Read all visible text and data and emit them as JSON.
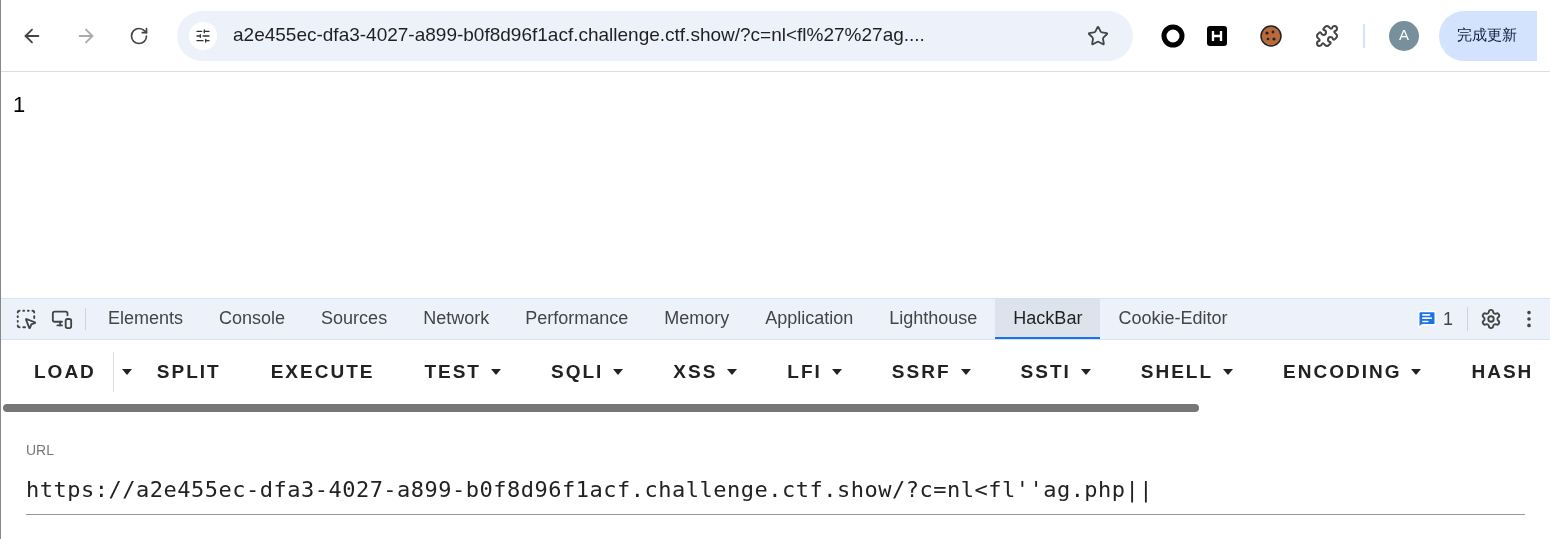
{
  "browser": {
    "address": "a2e455ec-dfa3-4027-a899-b0f8d96f1acf.challenge.ctf.show/?c=nl<fl%27%27ag....",
    "forward_disabled": true,
    "avatar": "A",
    "update_button": "完成更新"
  },
  "page": {
    "text": "1"
  },
  "devtools": {
    "tabs": [
      {
        "label": "Elements",
        "selected": false
      },
      {
        "label": "Console",
        "selected": false
      },
      {
        "label": "Sources",
        "selected": false
      },
      {
        "label": "Network",
        "selected": false
      },
      {
        "label": "Performance",
        "selected": false
      },
      {
        "label": "Memory",
        "selected": false
      },
      {
        "label": "Application",
        "selected": false
      },
      {
        "label": "Lighthouse",
        "selected": false
      },
      {
        "label": "HackBar",
        "selected": true
      },
      {
        "label": "Cookie-Editor",
        "selected": false
      }
    ],
    "issues_count": "1"
  },
  "hackbar": {
    "buttons": [
      {
        "label": "LOAD",
        "kind": "split"
      },
      {
        "label": "SPLIT",
        "kind": "plain"
      },
      {
        "label": "EXECUTE",
        "kind": "plain"
      },
      {
        "label": "TEST",
        "kind": "menu"
      },
      {
        "label": "SQLI",
        "kind": "menu"
      },
      {
        "label": "XSS",
        "kind": "menu"
      },
      {
        "label": "LFI",
        "kind": "menu"
      },
      {
        "label": "SSRF",
        "kind": "menu"
      },
      {
        "label": "SSTI",
        "kind": "menu"
      },
      {
        "label": "SHELL",
        "kind": "menu"
      },
      {
        "label": "ENCODING",
        "kind": "menu"
      },
      {
        "label": "HASH",
        "kind": "plain"
      }
    ],
    "url_label": "URL",
    "url_value": "https://a2e455ec-dfa3-4027-a899-b0f8d96f1acf.challenge.ctf.show/?c=nl<fl''ag.php||"
  }
}
